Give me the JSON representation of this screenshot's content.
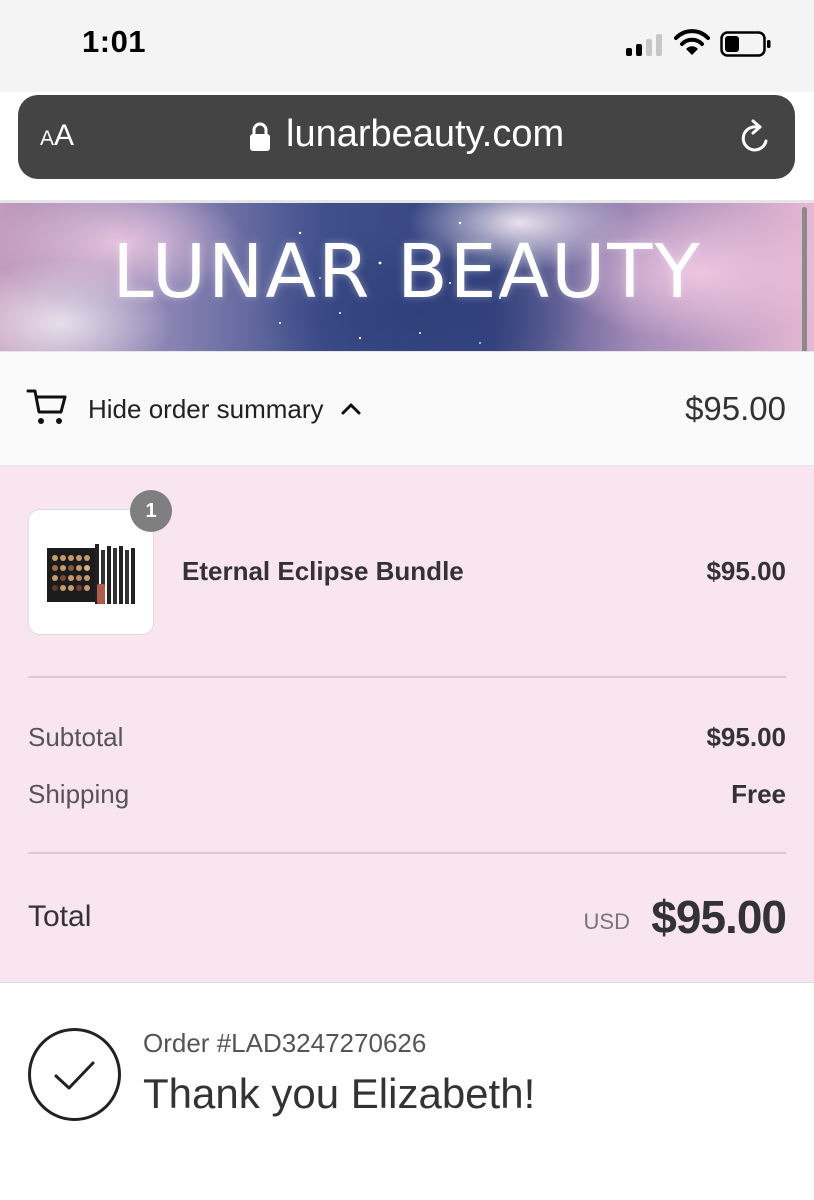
{
  "status_bar": {
    "time": "1:01"
  },
  "browser": {
    "text_size_label_small": "A",
    "text_size_label_large": "A",
    "url": "lunarbeauty.com"
  },
  "banner": {
    "logo_text": "LUNAR BEAUTY"
  },
  "summary_toggle": {
    "label": "Hide order summary",
    "total": "$95.00"
  },
  "order": {
    "items": [
      {
        "name": "Eternal Eclipse Bundle",
        "price": "$95.00",
        "quantity": "1"
      }
    ],
    "subtotal_label": "Subtotal",
    "subtotal_value": "$95.00",
    "shipping_label": "Shipping",
    "shipping_value": "Free",
    "total_label": "Total",
    "currency": "USD",
    "total_value": "$95.00"
  },
  "confirmation": {
    "order_number": "Order #LAD3247270626",
    "message": "Thank you Elizabeth!"
  },
  "colors": {
    "url_bar": "#444444",
    "summary_background": "#f9e5f0",
    "toggle_background": "#fafafa"
  },
  "icons": [
    "signal-icon",
    "wifi-icon",
    "battery-icon",
    "lock-icon",
    "reload-icon",
    "cart-icon",
    "chevron-up-icon",
    "checkmark-icon"
  ]
}
